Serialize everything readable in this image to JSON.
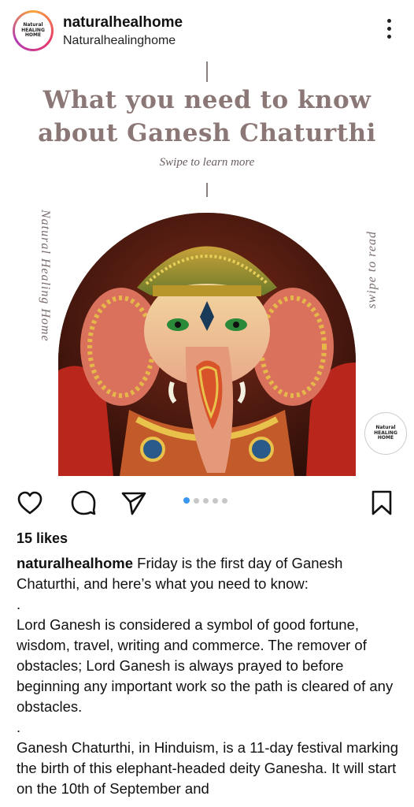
{
  "header": {
    "username": "naturalhealhome",
    "subtitle": "Naturalhealinghome",
    "avatar_logo": "Natural HEALING HOME"
  },
  "post": {
    "headline_line1": "What you need to know",
    "headline_line2": "about Ganesh Chaturthi",
    "swipe_text": "Swipe to learn more",
    "side_left": "Natural Healing Home",
    "side_right": "swipe to read",
    "badge_logo": "Natural HEALING HOME",
    "carousel": {
      "total": 5,
      "active_index": 0
    }
  },
  "actions": {
    "like_icon": "heart-icon",
    "comment_icon": "comment-icon",
    "share_icon": "send-icon",
    "save_icon": "bookmark-icon"
  },
  "likes": "15 likes",
  "caption": {
    "username": "naturalhealhome",
    "intro": " Friday is the first day of Ganesh Chaturthi, and here’s what you need to know:",
    "sep1": ".",
    "para1": "Lord Ganesh is considered a symbol of good fortune, wisdom, travel, writing and commerce. The remover of obstacles; Lord Ganesh is always prayed to before beginning any important work so the path is cleared of any obstacles.",
    "sep2": ".",
    "para2": "Ganesh Chaturthi, in Hinduism, is a 11-day festival marking the birth of this elephant-headed deity Ganesha. It will start on the 10th of September and"
  },
  "colors": {
    "headline": "#8b7876",
    "carousel_active": "#3897f0",
    "carousel_inactive": "#c7c7c7"
  }
}
